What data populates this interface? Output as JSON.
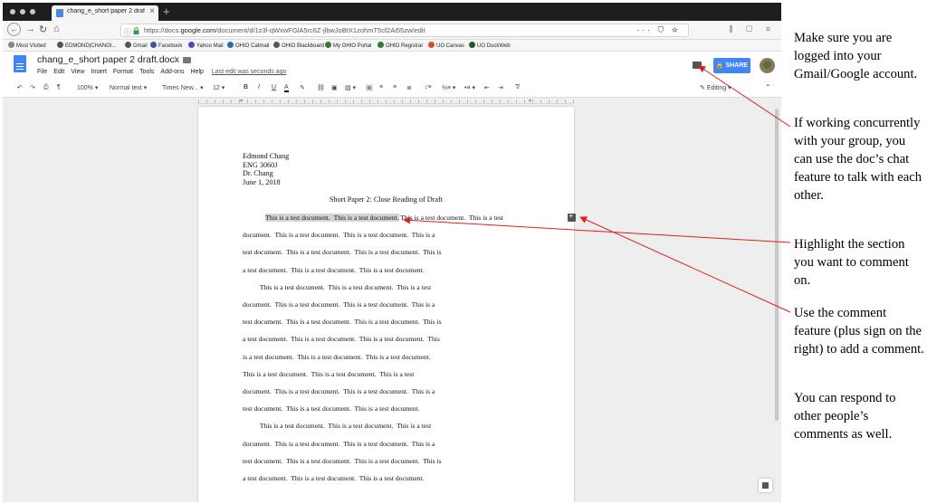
{
  "browser": {
    "tab_title": "chang_e_short paper 2 draft.docx",
    "new_tab_symbol": "+",
    "url_prefix": "https://docs.",
    "url_domain": "google.com",
    "url_path": "/document/d/1z3l-qWxwFGlA5rc6Z-jlbwJoBtX1zohmT5cf2Ai55zw/edit",
    "url_actions": "··· ⛉ ☆",
    "bookmarks": [
      {
        "label": "Most Visited",
        "color": "#888888"
      },
      {
        "label": "EDMOND|CHANGI...",
        "color": "#555555"
      },
      {
        "label": "Gmail",
        "color": "#555555"
      },
      {
        "label": "Facebook",
        "color": "#3b5998"
      },
      {
        "label": "Yahoo Mail",
        "color": "#6d3bbd"
      },
      {
        "label": "OHIO Catmail",
        "color": "#2b6cb0"
      },
      {
        "label": "OHIO Blackboard",
        "color": "#555555"
      },
      {
        "label": "My OHIO Portal",
        "color": "#2e7d32"
      },
      {
        "label": "OHIO Registrar",
        "color": "#2e7d32"
      },
      {
        "label": "UO Canvas",
        "color": "#e24a2b"
      },
      {
        "label": "UO DuckWeb",
        "color": "#1b5e20"
      }
    ]
  },
  "docs": {
    "title": "chang_e_short paper 2 draft.docx",
    "menu": [
      "File",
      "Edit",
      "View",
      "Insert",
      "Format",
      "Tools",
      "Add-ons",
      "Help"
    ],
    "last_edit": "Last edit was seconds ago",
    "share_label": "SHARE",
    "toolbar": {
      "zoom": "100%",
      "style": "Normal text",
      "font": "Times New...",
      "size": "12",
      "bold": "B",
      "italic": "I",
      "underline": "U",
      "text_color": "A",
      "mode": "Editing"
    }
  },
  "document": {
    "header_lines": [
      "Edmond Chang",
      "ENG 3060J",
      "Dr. Chang",
      "June 1, 2018"
    ],
    "heading": "Short Paper 2: Close Reading of Draft",
    "highlighted_text": "This is a test document.  This is a test document.",
    "body_lines": [
      " This is a test document.  This is a test",
      "document.  This is a test document.  This is a test document.  This is a",
      "test document.  This is a test document.  This is a test document.  This is",
      "a test document.  This is a test document.  This is a test document.",
      "          This is a test document.  This is a test document.  This is a test",
      "document.  This is a test document.  This is a test document.  This is a",
      "test document.  This is a test document.  This is a test document.  This is",
      "a test document.  This is a test document.  This is a test document.  This",
      "is a test document.  This is a test document.  This is a test document.",
      "This is a test document.  This is a test document.  This is a test",
      "document.  This is a test document.  This is a test document.  This is a",
      "test document.  This is a test document.  This is a test document.",
      "          This is a test document.  This is a test document.  This is a test",
      "document.  This is a test document.  This is a test document.  This is a",
      "test document.  This is a test document.  This is a test document.  This is",
      "a test document.  This is a test document.  This is a test document."
    ]
  },
  "annotations": {
    "login": "Make sure you are logged into your Gmail/Google account.",
    "chat": "If working concurrently with your group, you can use the doc’s chat feature to talk with each other.",
    "highlight": "Highlight the section you want to comment on.",
    "comment": "Use the comment feature (plus sign on the right) to add a comment.",
    "respond": "You can respond to other people’s comments as well.",
    "arrow_color": "#e02020"
  }
}
